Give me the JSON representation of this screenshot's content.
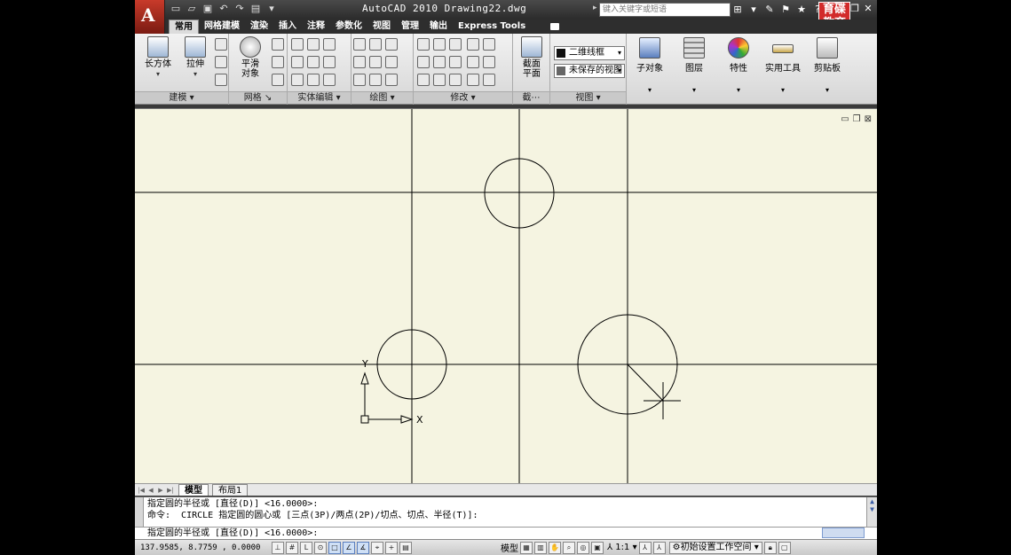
{
  "titlebar": {
    "app_title": "AutoCAD 2010  Drawing22.dwg",
    "search_placeholder": "键入关键字或短语",
    "watermark": "育碟教育"
  },
  "ribbon_tabs": [
    "常用",
    "网格建模",
    "渲染",
    "插入",
    "注释",
    "参数化",
    "视图",
    "管理",
    "输出",
    "Express Tools"
  ],
  "active_tab": "常用",
  "panels": {
    "modeling": {
      "title": "建模",
      "box_label": "长方体",
      "extrude_label": "拉伸"
    },
    "mesh": {
      "title": "网格",
      "smooth_label_line1": "平滑",
      "smooth_label_line2": "对象"
    },
    "solid_edit": {
      "title": "实体编辑"
    },
    "draw": {
      "title": "绘图"
    },
    "modify": {
      "title": "修改"
    },
    "section": {
      "title": "截⋯",
      "plane_label_line1": "截面",
      "plane_label_line2": "平面"
    },
    "view": {
      "title": "视图",
      "visual_style": "二维线框",
      "saved_view": "未保存的视图"
    },
    "subobject": {
      "label": "子对象"
    },
    "layers": {
      "label": "图层"
    },
    "properties": {
      "label": "特性"
    },
    "utilities": {
      "label": "实用工具"
    },
    "clipboard": {
      "label": "剪贴板"
    }
  },
  "layout_tabs": [
    "模型",
    "布局1"
  ],
  "active_layout": "模型",
  "command_history": [
    "指定圆的半径或 [直径(D)] <16.0000>:",
    "命令:  CIRCLE 指定圆的圆心或 [三点(3P)/两点(2P)/切点、切点、半径(T)]:"
  ],
  "command_prompt": "指定圆的半径或 [直径(D)] <16.0000>:",
  "ucs": {
    "x_label": "X",
    "y_label": "Y"
  },
  "status": {
    "coordinates": "137.9585, 8.7759 , 0.0000",
    "model_label": "模型",
    "annotation_scale": "1:1",
    "workspace": "初始设置工作空间"
  }
}
